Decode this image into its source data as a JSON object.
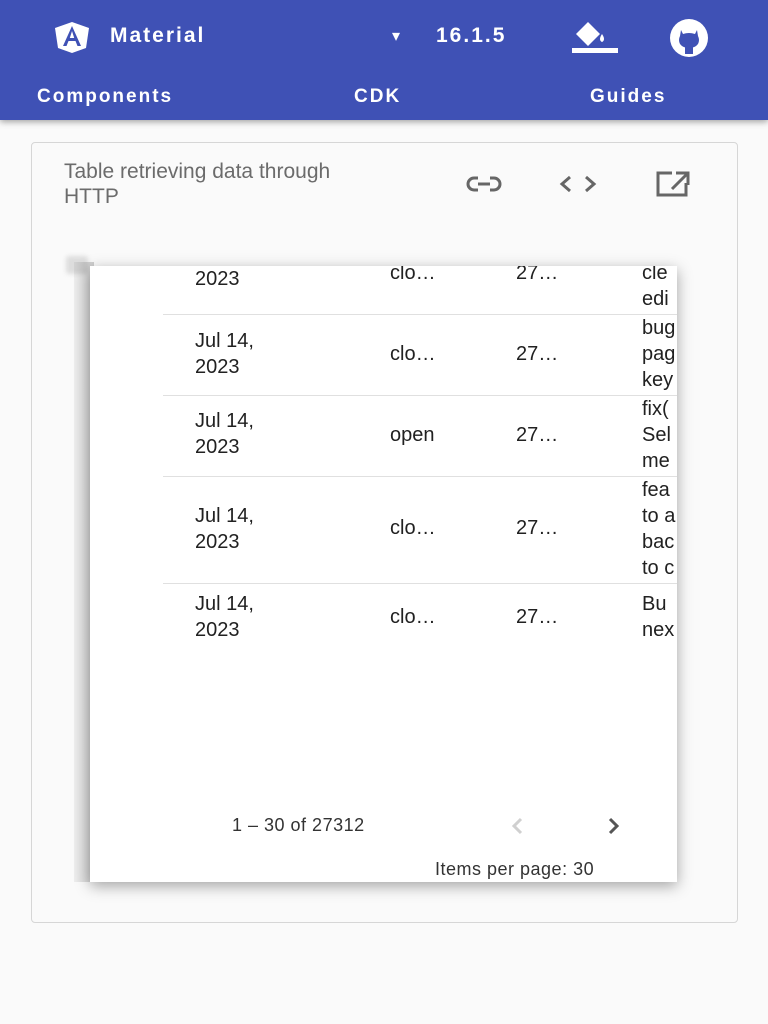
{
  "header": {
    "brand": "Material",
    "version": "16.1.5",
    "nav": [
      "Components",
      "CDK",
      "Guides"
    ],
    "icons": [
      "angular-logo-icon",
      "caret-down-icon",
      "theme-picker-icon",
      "github-icon"
    ],
    "colors": {
      "toolbar": "#3f51b5",
      "text": "#ffffff"
    }
  },
  "example": {
    "title": "Table retrieving data through HTTP",
    "icons": [
      "link-icon",
      "code-icon",
      "open-in-new-icon"
    ]
  },
  "table": {
    "rows": [
      {
        "date_line1": "",
        "date_line2": "2023",
        "state": "clo…",
        "number": "27…",
        "title": "cle\nedi"
      },
      {
        "date_line1": "Jul 14,",
        "date_line2": "2023",
        "state": "clo…",
        "number": "27…",
        "title": "bug\npag\nkey"
      },
      {
        "date_line1": "Jul 14,",
        "date_line2": "2023",
        "state": "open",
        "number": "27…",
        "title": "fix(\nSel\nme"
      },
      {
        "date_line1": "Jul 14,",
        "date_line2": "2023",
        "state": "clo…",
        "number": "27…",
        "title": "fea\nto a\nbac\nto c"
      },
      {
        "date_line1": "Jul 14,",
        "date_line2": "2023",
        "state": "clo…",
        "number": "27…",
        "title": "Bu\nnex"
      }
    ]
  },
  "paginator": {
    "range": "1 – 30 of 27312",
    "items_per_page": "Items per page: 30",
    "prev_icon": "chevron-left-icon",
    "next_icon": "chevron-right-icon"
  }
}
